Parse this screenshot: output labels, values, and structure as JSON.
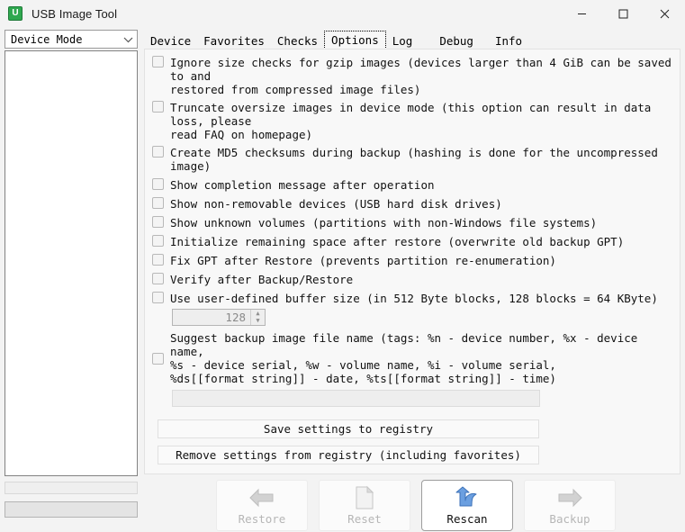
{
  "window": {
    "title": "USB Image Tool",
    "icon": "usb-app-icon",
    "icon_letter": "U",
    "accent": "#2fa84f",
    "controls": {
      "minimize": "minimize-icon",
      "maximize": "maximize-icon",
      "close": "close-icon"
    }
  },
  "sidebar": {
    "mode_select": {
      "value": "Device Mode",
      "chevron": "chevron-down-icon"
    },
    "device_list": {
      "items": []
    },
    "progress": {
      "value": ""
    },
    "status": {
      "text": ""
    }
  },
  "tabs": {
    "selected": "Options",
    "items": [
      {
        "label": "Device"
      },
      {
        "label": "Favorites"
      },
      {
        "label": "Checks"
      },
      {
        "label": "Options"
      },
      {
        "label": "Log"
      },
      {
        "label": "Debug"
      },
      {
        "label": "Info"
      }
    ]
  },
  "options": {
    "checkboxes": [
      {
        "label": "Ignore size checks for gzip images (devices larger than 4 GiB can be saved to and\nrestored from compressed image files)",
        "checked": false
      },
      {
        "label": "Truncate oversize images in device mode (this option can result in data loss, please\nread FAQ on homepage)",
        "checked": false
      },
      {
        "label": "Create MD5 checksums during backup (hashing is done for the uncompressed image)",
        "checked": false
      },
      {
        "label": "Show completion message after operation",
        "checked": false
      },
      {
        "label": "Show non-removable devices (USB hard disk drives)",
        "checked": false
      },
      {
        "label": "Show unknown volumes (partitions with non-Windows file systems)",
        "checked": false
      },
      {
        "label": "Initialize remaining space after restore (overwrite old backup GPT)",
        "checked": false
      },
      {
        "label": "Fix GPT after Restore (prevents partition re-enumeration)",
        "checked": false
      },
      {
        "label": "Verify after Backup/Restore",
        "checked": false
      },
      {
        "label": "Use user-defined buffer size (in 512 Byte blocks, 128 blocks = 64 KByte)",
        "checked": false
      }
    ],
    "buffer_spinner": {
      "value": "128",
      "up": "spinner-up-icon",
      "down": "spinner-down-icon"
    },
    "suggest": {
      "label": "Suggest backup image file name (tags: %n - device number, %x - device name,\n%s - device serial, %w - volume name, %i - volume serial,\n%ds[[format string]] - date, %ts[[format string]] - time)",
      "checked": false
    },
    "filename_pattern": {
      "value": "",
      "placeholder": ""
    },
    "save_button": "Save settings to registry",
    "remove_button": "Remove settings from registry (including favorites)"
  },
  "toolbar": {
    "buttons": [
      {
        "label": "Restore",
        "icon": "arrow-left-icon",
        "enabled": false
      },
      {
        "label": "Reset",
        "icon": "document-icon",
        "enabled": false
      },
      {
        "label": "Rescan",
        "icon": "refresh-arrow-icon",
        "enabled": true
      },
      {
        "label": "Backup",
        "icon": "arrow-right-icon",
        "enabled": false
      }
    ]
  }
}
